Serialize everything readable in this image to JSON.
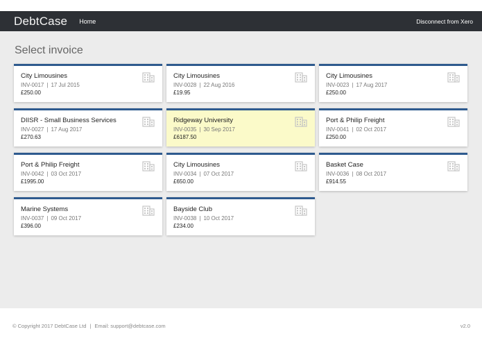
{
  "nav": {
    "brand": "DebtCase",
    "home": "Home",
    "disconnect": "Disconnect from Xero"
  },
  "page": {
    "title": "Select invoice"
  },
  "invoices": [
    {
      "name": "City Limousines",
      "number": "INV-0017",
      "date": "17 Jul 2015",
      "amount": "£250.00",
      "highlighted": false
    },
    {
      "name": "City Limousines",
      "number": "INV-0028",
      "date": "22 Aug 2016",
      "amount": "£19.95",
      "highlighted": false
    },
    {
      "name": "City Limousines",
      "number": "INV-0023",
      "date": "17 Aug 2017",
      "amount": "£250.00",
      "highlighted": false
    },
    {
      "name": "DIISR - Small Business Services",
      "number": "INV-0027",
      "date": "17 Aug 2017",
      "amount": "£270.63",
      "highlighted": false
    },
    {
      "name": "Ridgeway University",
      "number": "INV-0035",
      "date": "30 Sep 2017",
      "amount": "£6187.50",
      "highlighted": true
    },
    {
      "name": "Port & Philip Freight",
      "number": "INV-0041",
      "date": "02 Oct 2017",
      "amount": "£250.00",
      "highlighted": false
    },
    {
      "name": "Port & Philip Freight",
      "number": "INV-0042",
      "date": "03 Oct 2017",
      "amount": "£1995.00",
      "highlighted": false
    },
    {
      "name": "City Limousines",
      "number": "INV-0034",
      "date": "07 Oct 2017",
      "amount": "£650.00",
      "highlighted": false
    },
    {
      "name": "Basket Case",
      "number": "INV-0036",
      "date": "08 Oct 2017",
      "amount": "£914.55",
      "highlighted": false
    },
    {
      "name": "Marine Systems",
      "number": "INV-0037",
      "date": "09 Oct 2017",
      "amount": "£396.00",
      "highlighted": false
    },
    {
      "name": "Bayside Club",
      "number": "INV-0038",
      "date": "10 Oct 2017",
      "amount": "£234.00",
      "highlighted": false
    }
  ],
  "card_icon": "building-icon",
  "meta_separator": "|",
  "colors": {
    "navbar": "#2d3035",
    "card_accent": "#2e5a8e",
    "highlight": "#fbfac9",
    "background": "#ececec"
  },
  "footer": {
    "copyright": "© Copyright 2017 DebtCase Ltd",
    "separator": "|",
    "email": "Email: support@debtcase.com",
    "version": "v2.0"
  }
}
